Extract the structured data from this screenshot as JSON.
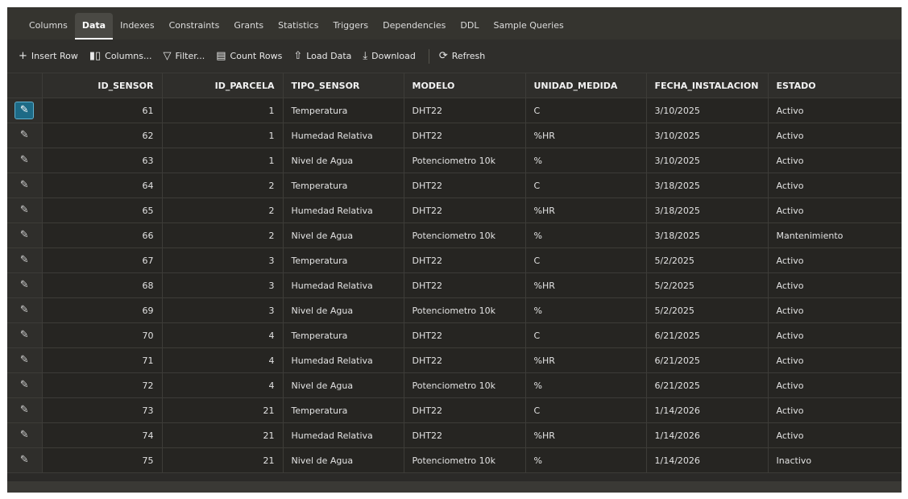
{
  "tabs": [
    {
      "label": "Columns",
      "active": false
    },
    {
      "label": "Data",
      "active": true
    },
    {
      "label": "Indexes",
      "active": false
    },
    {
      "label": "Constraints",
      "active": false
    },
    {
      "label": "Grants",
      "active": false
    },
    {
      "label": "Statistics",
      "active": false
    },
    {
      "label": "Triggers",
      "active": false
    },
    {
      "label": "Dependencies",
      "active": false
    },
    {
      "label": "DDL",
      "active": false
    },
    {
      "label": "Sample Queries",
      "active": false
    }
  ],
  "toolbar": {
    "insert_row": "Insert Row",
    "columns": "Columns...",
    "filter": "Filter...",
    "count_rows": "Count Rows",
    "load_data": "Load Data",
    "download": "Download",
    "refresh": "Refresh"
  },
  "grid": {
    "headers": [
      "ID_SENSOR",
      "ID_PARCELA",
      "TIPO_SENSOR",
      "MODELO",
      "UNIDAD_MEDIDA",
      "FECHA_INSTALACION",
      "ESTADO"
    ],
    "rows": [
      [
        "61",
        "1",
        "Temperatura",
        "DHT22",
        "C",
        "3/10/2025",
        "Activo"
      ],
      [
        "62",
        "1",
        "Humedad Relativa",
        "DHT22",
        "%HR",
        "3/10/2025",
        "Activo"
      ],
      [
        "63",
        "1",
        "Nivel de Agua",
        "Potenciometro 10k",
        "%",
        "3/10/2025",
        "Activo"
      ],
      [
        "64",
        "2",
        "Temperatura",
        "DHT22",
        "C",
        "3/18/2025",
        "Activo"
      ],
      [
        "65",
        "2",
        "Humedad Relativa",
        "DHT22",
        "%HR",
        "3/18/2025",
        "Activo"
      ],
      [
        "66",
        "2",
        "Nivel de Agua",
        "Potenciometro 10k",
        "%",
        "3/18/2025",
        "Mantenimiento"
      ],
      [
        "67",
        "3",
        "Temperatura",
        "DHT22",
        "C",
        "5/2/2025",
        "Activo"
      ],
      [
        "68",
        "3",
        "Humedad Relativa",
        "DHT22",
        "%HR",
        "5/2/2025",
        "Activo"
      ],
      [
        "69",
        "3",
        "Nivel de Agua",
        "Potenciometro 10k",
        "%",
        "5/2/2025",
        "Activo"
      ],
      [
        "70",
        "4",
        "Temperatura",
        "DHT22",
        "C",
        "6/21/2025",
        "Activo"
      ],
      [
        "71",
        "4",
        "Humedad Relativa",
        "DHT22",
        "%HR",
        "6/21/2025",
        "Activo"
      ],
      [
        "72",
        "4",
        "Nivel de Agua",
        "Potenciometro 10k",
        "%",
        "6/21/2025",
        "Activo"
      ],
      [
        "73",
        "21",
        "Temperatura",
        "DHT22",
        "C",
        "1/14/2026",
        "Activo"
      ],
      [
        "74",
        "21",
        "Humedad Relativa",
        "DHT22",
        "%HR",
        "1/14/2026",
        "Activo"
      ],
      [
        "75",
        "21",
        "Nivel de Agua",
        "Potenciometro 10k",
        "%",
        "1/14/2026",
        "Inactivo"
      ]
    ]
  },
  "icons": {
    "insert_row": "plus-icon",
    "columns": "columns-icon",
    "filter": "filter-icon",
    "count_rows": "count-rows-icon",
    "load_data": "upload-icon",
    "download": "download-icon",
    "refresh": "refresh-icon",
    "edit": "pencil-icon"
  },
  "colors": {
    "selected_row_marker": "#1d6a86"
  }
}
